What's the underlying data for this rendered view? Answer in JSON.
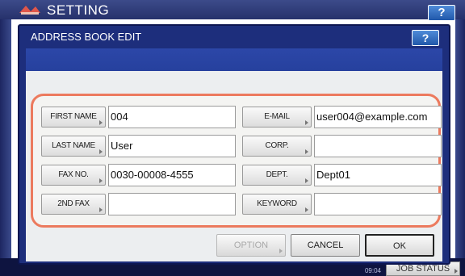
{
  "background": {
    "title": "SETTING",
    "help_label": "?",
    "clock_time": "09:04",
    "job_status_label": "JOB STATUS"
  },
  "dialog": {
    "title": "ADDRESS BOOK EDIT",
    "help_label": "?",
    "fields": [
      {
        "label": "FIRST NAME",
        "value": "004"
      },
      {
        "label": "LAST NAME",
        "value": "User"
      },
      {
        "label": "FAX NO.",
        "value": "0030-00008-4555"
      },
      {
        "label": "2ND FAX",
        "value": ""
      },
      {
        "label": "E-MAIL",
        "value": "user004@example.com"
      },
      {
        "label": "CORP.",
        "value": ""
      },
      {
        "label": "DEPT.",
        "value": "Dept01"
      },
      {
        "label": "KEYWORD",
        "value": ""
      }
    ],
    "buttons": {
      "option": "OPTION",
      "cancel": "CANCEL",
      "ok": "OK"
    }
  },
  "colors": {
    "dialog_frame": "#1d2e7c",
    "highlight_outline": "#ec7a5e"
  }
}
